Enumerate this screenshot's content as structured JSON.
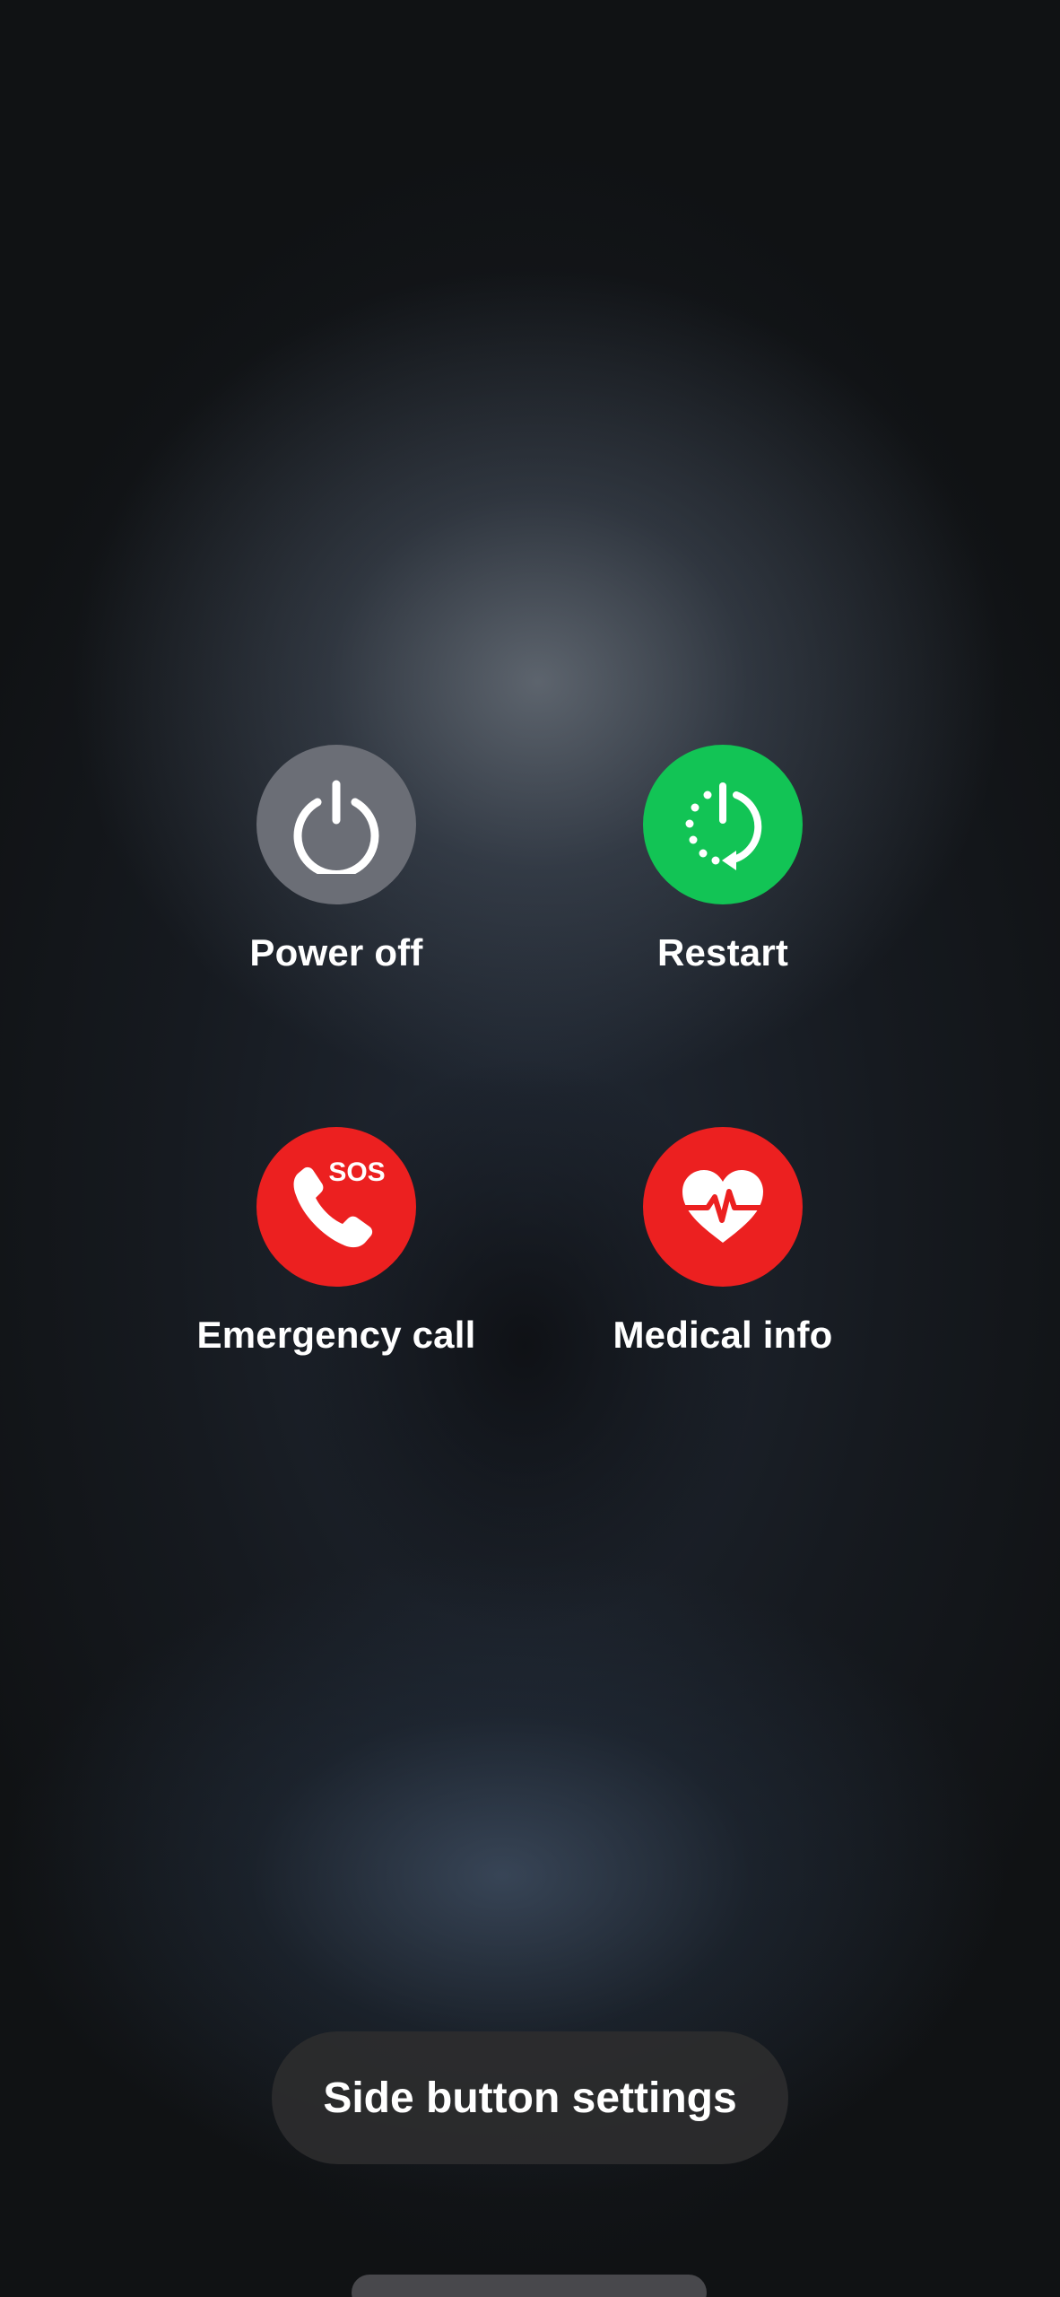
{
  "power_menu": {
    "options": [
      {
        "label": "Power off",
        "icon": "power-icon",
        "color": "#6b6e76"
      },
      {
        "label": "Restart",
        "icon": "restart-icon",
        "color": "#12c455"
      },
      {
        "label": "Emergency call",
        "icon": "sos-phone-icon",
        "color": "#ec2020",
        "badge": "SOS"
      },
      {
        "label": "Medical info",
        "icon": "heart-pulse-icon",
        "color": "#ec2020"
      }
    ]
  },
  "side_button_settings": {
    "label": "Side button settings"
  },
  "colors": {
    "pill_background": "#2c2c2e",
    "label_text": "#ffffff"
  }
}
